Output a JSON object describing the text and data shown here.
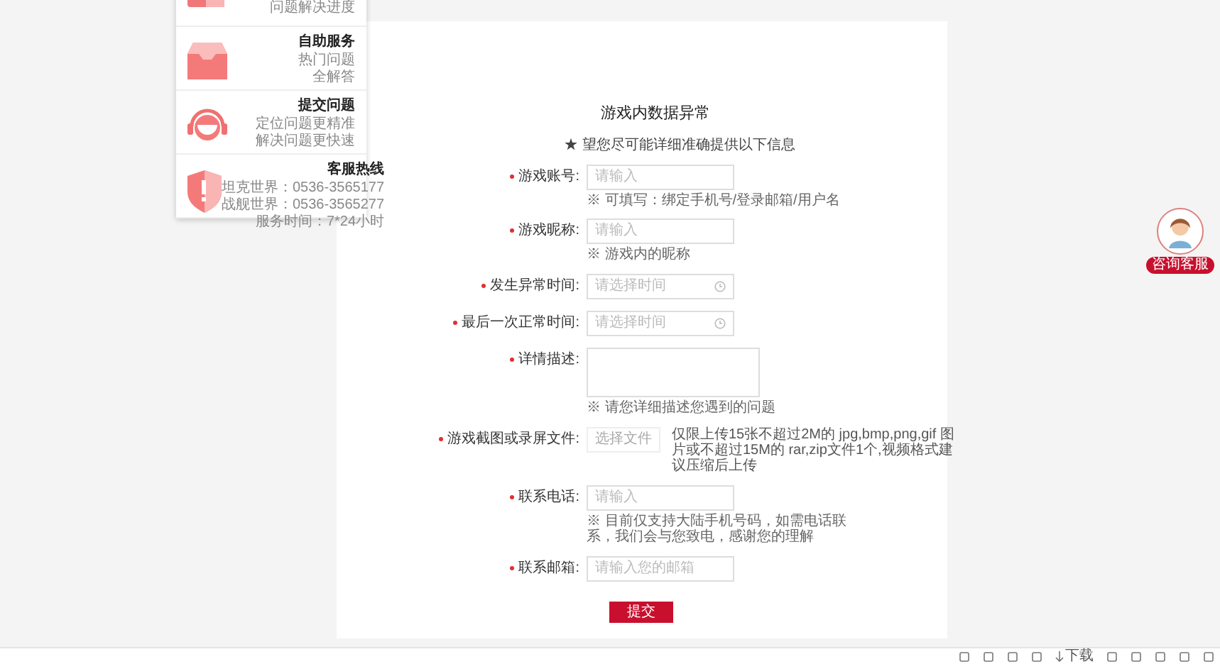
{
  "sidebar": {
    "items": [
      {
        "kind": "progress",
        "lines": [
          "问题解决进度"
        ]
      },
      {
        "kind": "self_service",
        "title": "自助服务",
        "lines": [
          "热门问题",
          "全解答"
        ]
      },
      {
        "kind": "submit",
        "title": "提交问题",
        "lines": [
          "定位问题更精准",
          "解决问题更快速"
        ]
      },
      {
        "kind": "hotline",
        "title": "客服热线",
        "lines": [
          "坦克世界：0536-3565177",
          "战舰世界：0536-3565277",
          "服务时间：7*24小时"
        ]
      }
    ]
  },
  "form": {
    "title": "游戏内数据异常",
    "notice": "★ 望您尽可能详细准确提供以下信息",
    "fields": [
      {
        "kind": "text",
        "required": true,
        "label": "游戏账号:",
        "placeholder": "请输入",
        "hint": "※ 可填写：绑定手机号/登录邮箱/用户名"
      },
      {
        "kind": "text",
        "required": true,
        "label": "游戏昵称:",
        "placeholder": "请输入",
        "hint": "※ 游戏内的昵称"
      },
      {
        "kind": "datetime",
        "required": true,
        "label": "发生异常时间:",
        "placeholder": "请选择时间"
      },
      {
        "kind": "datetime",
        "required": true,
        "label": "最后一次正常时间:",
        "placeholder": "请选择时间"
      },
      {
        "kind": "textarea",
        "required": true,
        "label": "详情描述:",
        "hint": "※ 请您详细描述您遇到的问题"
      },
      {
        "kind": "file",
        "required": true,
        "label": "游戏截图或录屏文件:",
        "button": "选择文件",
        "hint": "仅限上传15张不超过2M的 jpg,bmp,png,gif 图片或不超过15M的 rar,zip文件1个,视频格式建议压缩后上传"
      },
      {
        "kind": "text",
        "required": true,
        "label": "联系电话:",
        "placeholder": "请输入",
        "hint": "※ 目前仅支持大陆手机号码，如需电话联系，我们会与您致电，感谢您的理解"
      },
      {
        "kind": "text",
        "required": true,
        "label": "联系邮箱:",
        "placeholder": "请输入您的邮箱"
      }
    ],
    "submit": "提交"
  },
  "support_widget": {
    "label": "咨询客服"
  },
  "status_bar": {
    "download": "下载"
  }
}
